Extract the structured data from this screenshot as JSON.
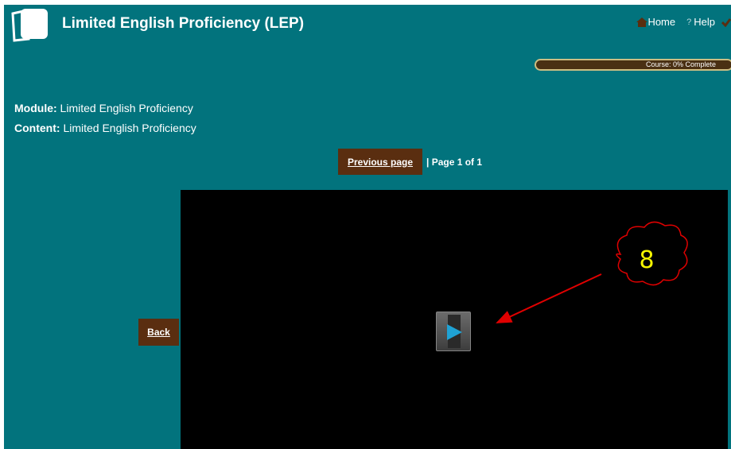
{
  "header": {
    "title": "Limited English Proficiency (LEP)",
    "home_label": "Home",
    "help_label": "Help",
    "icons": [
      "logo-icon",
      "home-icon",
      "help-icon",
      "check-icon"
    ]
  },
  "progress": {
    "label": "Course: 0% Complete",
    "value": 0
  },
  "meta": {
    "module_key": "Module:",
    "module_value": "Limited English Proficiency",
    "content_key": "Content:",
    "content_value": "Limited English Proficiency"
  },
  "pager": {
    "previous_label": "Previous page",
    "page_info": "| Page 1 of 1"
  },
  "back_label": "Back",
  "video": {
    "play_icon": "play-icon"
  },
  "annotation": {
    "number": "8",
    "color": "#e00000"
  },
  "colors": {
    "background": "#02737d",
    "button": "#5a2e10",
    "video": "#000000"
  }
}
